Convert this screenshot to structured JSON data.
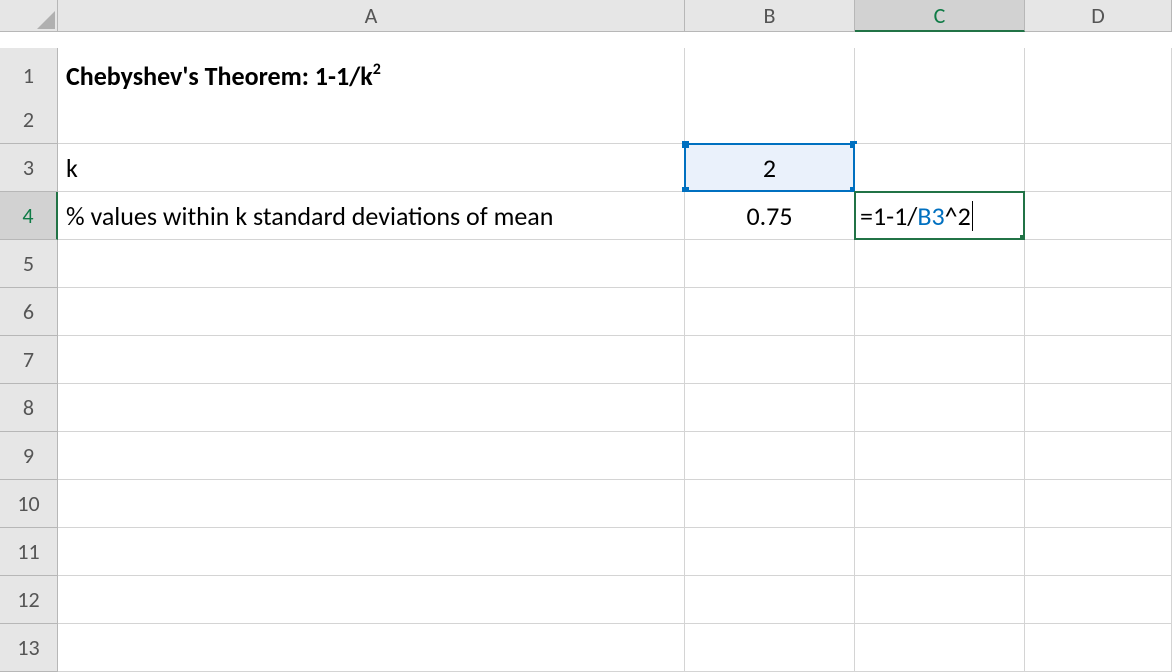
{
  "columns": [
    "A",
    "B",
    "C",
    "D"
  ],
  "rows": [
    "1",
    "2",
    "3",
    "4",
    "5",
    "6",
    "7",
    "8",
    "9",
    "10",
    "11",
    "12",
    "13"
  ],
  "active": {
    "cell": "C4",
    "row": "4",
    "col": "C"
  },
  "referenced": {
    "cell": "B3"
  },
  "cells": {
    "A1": {
      "parts": [
        {
          "text": "Chebyshev's Theorem: 1-1/k",
          "style": ""
        },
        {
          "text": "2",
          "style": "sup"
        }
      ],
      "bold": true
    },
    "A3": {
      "text": "k"
    },
    "B3": {
      "text": "2",
      "align": "center"
    },
    "A4": {
      "text": "% values within k standard deviations of mean"
    },
    "B4": {
      "text": "0.75",
      "align": "center"
    },
    "C4": {
      "editing": true,
      "formula_parts": [
        {
          "text": "=1-1/",
          "ref": false
        },
        {
          "text": "B3",
          "ref": true
        },
        {
          "text": "^2",
          "ref": false
        }
      ]
    }
  }
}
